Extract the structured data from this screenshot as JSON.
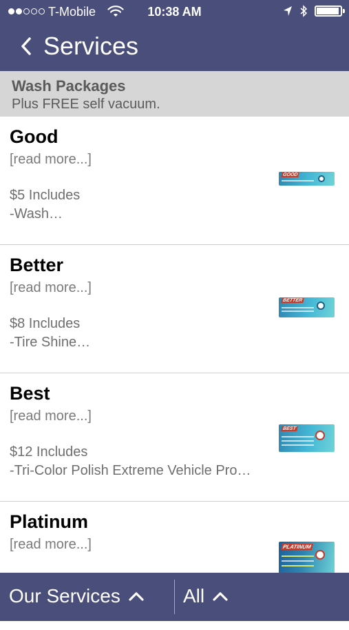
{
  "status": {
    "carrier": "T-Mobile",
    "time": "10:38 AM",
    "signal_bars_filled": 2,
    "signal_bars_total": 5,
    "battery_level": 0.95
  },
  "nav": {
    "title": "Services",
    "back_icon": "chevron-left-icon"
  },
  "section": {
    "title": "Wash Packages",
    "subtitle": "Plus FREE self vacuum."
  },
  "items": [
    {
      "name": "Good",
      "more": "[read more...]",
      "price": "$5 Includes",
      "desc": "-Wash…",
      "tag": "GOOD"
    },
    {
      "name": "Better",
      "more": "[read more...]",
      "price": "$8 Includes",
      "desc": "-Tire Shine…",
      "tag": "BETTER"
    },
    {
      "name": "Best",
      "more": "[read more...]",
      "price": "$12 Includes",
      "desc": "-Tri-Color Polish Extreme Vehicle Pro…",
      "tag": "BEST"
    },
    {
      "name": "Platinum",
      "more": "[read more...]",
      "price": "",
      "desc": "",
      "tag": "PLATINUM"
    }
  ],
  "bottom": {
    "services_label": "Our Services",
    "all_label": "All"
  },
  "colors": {
    "bar": "#4a4e7a",
    "section_bg": "#d6d6d6"
  }
}
